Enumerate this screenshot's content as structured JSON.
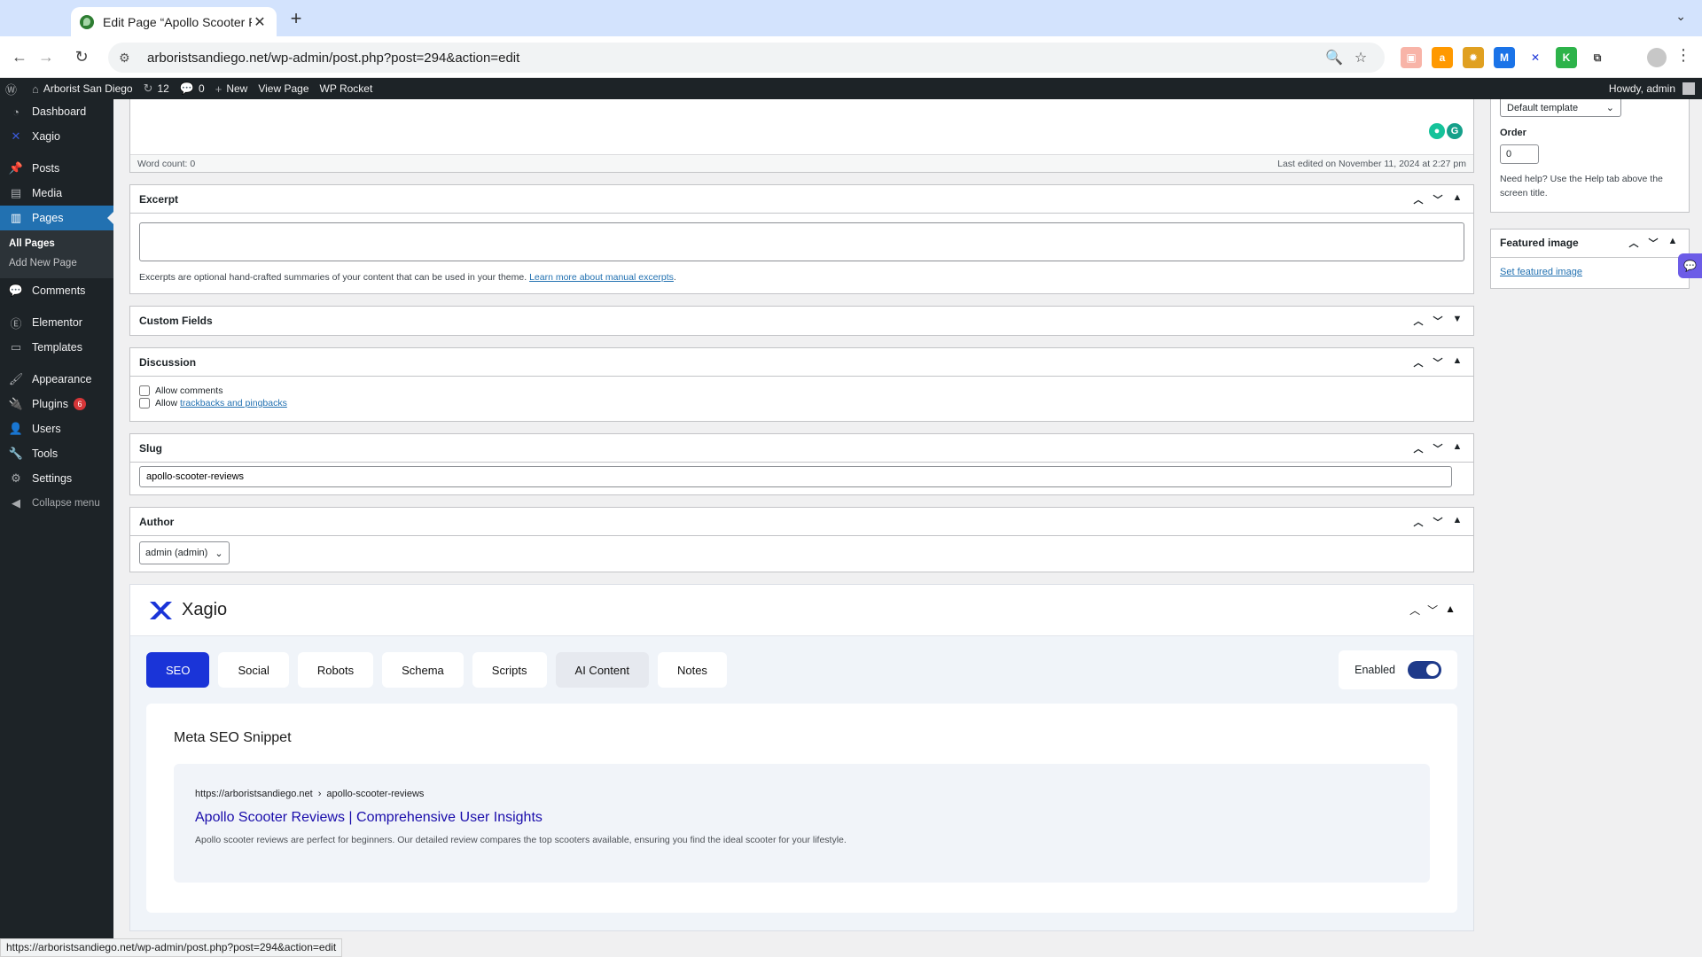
{
  "browser": {
    "tab_title": "Edit Page “Apollo Scooter Re",
    "url": "arboristsandiego.net/wp-admin/post.php?post=294&action=edit",
    "status_url": "https://arboristsandiego.net/wp-admin/post.php?post=294&action=edit"
  },
  "adminbar": {
    "site_name": "Arborist San Diego",
    "updates": "12",
    "comments": "0",
    "new_label": "New",
    "view_label": "View Page",
    "rocket_label": "WP Rocket",
    "howdy": "Howdy, admin"
  },
  "sidebar": {
    "dashboard": "Dashboard",
    "xagio": "Xagio",
    "posts": "Posts",
    "media": "Media",
    "pages": "Pages",
    "all_pages": "All Pages",
    "add_new_page": "Add New Page",
    "comments": "Comments",
    "elementor": "Elementor",
    "templates": "Templates",
    "appearance": "Appearance",
    "plugins": "Plugins",
    "plugins_badge": "6",
    "users": "Users",
    "tools": "Tools",
    "settings": "Settings",
    "collapse": "Collapse menu"
  },
  "editor": {
    "word_count": "Word count: 0",
    "last_edited": "Last edited on November 11, 2024 at 2:27 pm"
  },
  "excerpt": {
    "title": "Excerpt",
    "help_text": "Excerpts are optional hand-crafted summaries of your content that can be used in your theme.",
    "help_link": "Learn more about manual excerpts",
    "help_end": "."
  },
  "custom_fields": {
    "title": "Custom Fields"
  },
  "discussion": {
    "title": "Discussion",
    "allow_comments": "Allow comments",
    "allow_prefix": "Allow",
    "trackbacks_link": "trackbacks and pingbacks"
  },
  "slug": {
    "title": "Slug",
    "value": "apollo-scooter-reviews"
  },
  "author": {
    "title": "Author",
    "value": "admin (admin)"
  },
  "xagio": {
    "name": "Xagio",
    "tabs": [
      "SEO",
      "Social",
      "Robots",
      "Schema",
      "Scripts",
      "AI Content",
      "Notes"
    ],
    "enabled_label": "Enabled",
    "snippet_heading": "Meta SEO Snippet",
    "snippet_domain": "https://arboristsandiego.net",
    "snippet_path": "apollo-scooter-reviews",
    "serp_title": "Apollo Scooter Reviews | Comprehensive User Insights",
    "serp_desc": "Apollo scooter reviews are perfect for beginners. Our detailed review compares the top scooters available, ensuring you find the ideal scooter for your lifestyle."
  },
  "page_attributes": {
    "template": "Default template",
    "order_label": "Order",
    "order_value": "0",
    "help": "Need help? Use the Help tab above the screen title."
  },
  "featured_image": {
    "title": "Featured image",
    "link": "Set featured image"
  }
}
